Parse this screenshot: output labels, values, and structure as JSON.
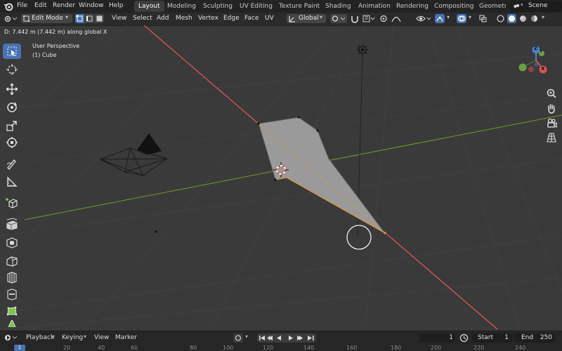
{
  "topbar": {
    "menus": [
      "File",
      "Edit",
      "Render",
      "Window",
      "Help"
    ],
    "workspaces": [
      "Layout",
      "Modeling",
      "Sculpting",
      "UV Editing",
      "Texture Paint",
      "Shading",
      "Animation",
      "Rendering",
      "Compositing",
      "Geometr"
    ],
    "active_workspace": "Layout",
    "scene": "Scene"
  },
  "header": {
    "mode": "Edit Mode",
    "menus": [
      "View",
      "Select",
      "Add",
      "Mesh",
      "Vertex",
      "Edge",
      "Face",
      "UV"
    ],
    "orientation": "Global"
  },
  "status": "D: 7.442 m (7.442 m) along global X",
  "viewport": {
    "view_name": "User Perspective",
    "object_name": "(1) Cube",
    "gizmo": {
      "z": "Z",
      "y": "Y",
      "x": "X"
    },
    "colors": {
      "x_axis": "#d9545a",
      "y_axis": "#6e9c2e",
      "mesh_face": "#9a9a9a",
      "selection": "#e59a3a"
    }
  },
  "timeline": {
    "menus": [
      "Playback",
      "Keying",
      "View",
      "Marker"
    ],
    "current_frame": "1",
    "start_label": "Start",
    "start_value": "1",
    "end_label": "End",
    "end_value": "250",
    "ruler": [
      "1",
      "20",
      "40",
      "60",
      "80",
      "100",
      "120",
      "140",
      "160",
      "180",
      "200",
      "220",
      "240"
    ]
  }
}
